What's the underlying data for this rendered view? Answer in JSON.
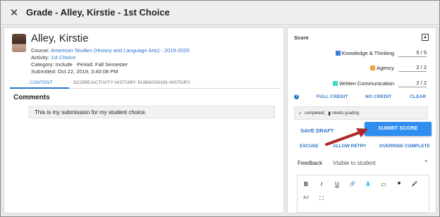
{
  "window": {
    "title": "Grade - Alley, Kirstie - 1st Choice",
    "close_glyph": "✕"
  },
  "student": {
    "name": "Alley, Kirstie",
    "course_label": "Course:",
    "course": "American Studies (History and Language Arts) - 2019-2020",
    "activity_label": "Activity:",
    "activity": "1st Choice",
    "category_line": "Category: Include   Period: Fall Semester",
    "submitted_line": "Submitted: Oct 22, 2019, 3:40:08 PM"
  },
  "tabs": [
    "CONTENT",
    "SCORE/ACTIVITY HISTORY",
    "SUBMISSION HISTORY"
  ],
  "comments": {
    "heading": "Comments",
    "text": "This is my submission for my student choice."
  },
  "score": {
    "heading": "Score",
    "collapse_glyph": "▲",
    "criteria": [
      {
        "label": "Knowledge & Thinking",
        "value": "5 / 5",
        "color": "#3d7ce0"
      },
      {
        "label": "Agency",
        "value": "2 / 2",
        "color": "#f0a23a"
      },
      {
        "label": "Written Communication",
        "value": "2 / 2",
        "color": "#45d6c8"
      }
    ],
    "help_glyph": "?",
    "quick_buttons": [
      "FULL CREDIT",
      "NO CREDIT",
      "CLEAR"
    ],
    "status": {
      "check_glyph": "✓",
      "completed": "completed,",
      "doc_glyph": "▮",
      "needs": "needs grading"
    }
  },
  "actions": {
    "save_draft": "SAVE DRAFT",
    "submit": "SUBMIT SCORE",
    "excuse": "EXCUSE",
    "allow_retry": "ALLOW RETRY",
    "override_complete": "OVERRIDE COMPLETE"
  },
  "feedback": {
    "label": "Feedback",
    "visibility": "Visible to student",
    "chevron": "⌃"
  },
  "toolbar": {
    "row1": [
      "B",
      "I",
      "U",
      "🔗",
      "💧",
      "▭",
      "■",
      "🎤"
    ],
    "row2": [
      "±√",
      "⛶"
    ]
  },
  "colors": {
    "accent": "#2c73c7",
    "submit": "#2f8ef0",
    "arrow": "#b0262a"
  }
}
